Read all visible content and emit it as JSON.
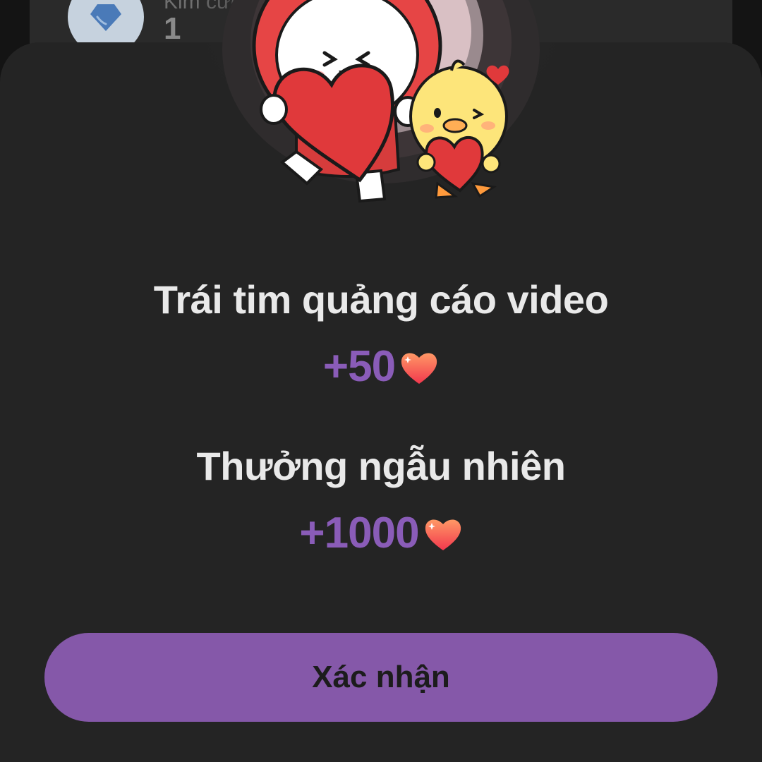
{
  "background_list": {
    "row_title": "Kim cương nhận được",
    "row_count": "1"
  },
  "dialog": {
    "illustration": "bunny-and-chick-holding-hearts",
    "rewards": [
      {
        "title": "Trái tim quảng cáo video",
        "amount": "+50",
        "icon": "heart-icon"
      },
      {
        "title": "Thưởng ngẫu nhiên",
        "amount": "+1000",
        "icon": "heart-icon"
      }
    ],
    "confirm_label": "Xác nhận"
  },
  "colors": {
    "sheet_background": "#242424",
    "accent_purple": "#8558a9",
    "amount_purple": "#8a5cb8",
    "title_text": "#e9e9e9",
    "heart_gradient_top": "#ff8a5c",
    "heart_gradient_bottom": "#f5314f"
  }
}
